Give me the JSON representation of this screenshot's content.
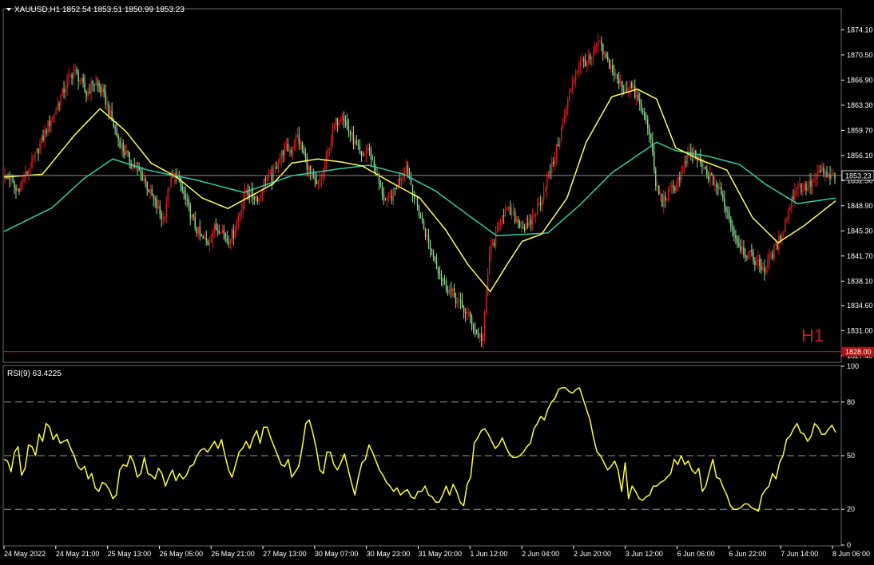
{
  "header": {
    "symbol": "XAUUSD,H1",
    "ohlc": "1852.54 1853.51 1850.99 1853.23"
  },
  "rsi_header": "RSI(9) 63.4225",
  "timeframe_badge": "H1",
  "current_price_label": "1853.23",
  "low_line_label": "1828.00",
  "colors": {
    "background": "#000000",
    "bull": "#d81f1f",
    "bear": "#8fdc8f",
    "ma_fast": "#ffff55",
    "ma_slow": "#2fd0a0",
    "rsi": "#ffff33",
    "low_line": "#b01010",
    "current_line": "#888888"
  },
  "chart_data": [
    {
      "type": "candlestick",
      "title": "XAUUSD,H1",
      "ylim": [
        1826.7,
        1877.0
      ],
      "yticks": [
        "1874.10",
        "1870.50",
        "1866.90",
        "1863.30",
        "1859.70",
        "1856.10",
        "1852.50",
        "1848.90",
        "1845.30",
        "1841.70",
        "1838.10",
        "1834.60",
        "1831.00",
        "1827.40"
      ],
      "xticks": [
        "24 May 2022",
        "24 May 21:00",
        "25 May 13:00",
        "26 May 05:00",
        "26 May 21:00",
        "27 May 13:00",
        "30 May 07:00",
        "30 May 23:00",
        "31 May 20:00",
        "1 Jun 12:00",
        "2 Jun 04:00",
        "2 Jun 20:00",
        "3 Jun 12:00",
        "6 Jun 06:00",
        "6 Jun 22:00",
        "7 Jun 14:00",
        "8 Jun 06:00"
      ],
      "current_price": 1853.23,
      "horizontal_line": 1828.0,
      "close_path": [
        [
          0,
          1852.8
        ],
        [
          4,
          1853.0
        ],
        [
          8,
          1851.0
        ],
        [
          12,
          1852.4
        ],
        [
          16,
          1854.2
        ],
        [
          20,
          1856.0
        ],
        [
          24,
          1858.2
        ],
        [
          28,
          1860.4
        ],
        [
          32,
          1862.2
        ],
        [
          36,
          1864.4
        ],
        [
          40,
          1866.6
        ],
        [
          44,
          1868.2
        ],
        [
          48,
          1867.0
        ],
        [
          52,
          1864.8
        ],
        [
          56,
          1866.6
        ],
        [
          60,
          1866.0
        ],
        [
          64,
          1864.0
        ],
        [
          68,
          1861.0
        ],
        [
          72,
          1858.4
        ],
        [
          76,
          1856.6
        ],
        [
          80,
          1855.0
        ],
        [
          84,
          1854.0
        ],
        [
          88,
          1852.8
        ],
        [
          92,
          1850.6
        ],
        [
          96,
          1848.8
        ],
        [
          100,
          1846.8
        ],
        [
          104,
          1852.0
        ],
        [
          108,
          1853.6
        ],
        [
          112,
          1851.0
        ],
        [
          116,
          1848.4
        ],
        [
          120,
          1846.0
        ],
        [
          124,
          1844.2
        ],
        [
          128,
          1843.6
        ],
        [
          132,
          1845.6
        ],
        [
          136,
          1845.8
        ],
        [
          140,
          1844.0
        ],
        [
          144,
          1845.0
        ],
        [
          148,
          1848.2
        ],
        [
          152,
          1851.2
        ],
        [
          156,
          1850.4
        ],
        [
          160,
          1850.0
        ],
        [
          164,
          1853.0
        ],
        [
          168,
          1852.8
        ],
        [
          172,
          1855.4
        ],
        [
          176,
          1857.2
        ],
        [
          180,
          1856.8
        ],
        [
          184,
          1858.8
        ],
        [
          188,
          1856.2
        ],
        [
          192,
          1853.4
        ],
        [
          196,
          1851.6
        ],
        [
          200,
          1853.4
        ],
        [
          204,
          1857.6
        ],
        [
          208,
          1860.8
        ],
        [
          212,
          1862.2
        ],
        [
          216,
          1859.6
        ],
        [
          220,
          1857.8
        ],
        [
          224,
          1855.6
        ],
        [
          228,
          1857.2
        ],
        [
          232,
          1854.6
        ],
        [
          236,
          1851.4
        ],
        [
          240,
          1849.2
        ],
        [
          244,
          1850.6
        ],
        [
          248,
          1853.0
        ],
        [
          252,
          1854.6
        ],
        [
          256,
          1851.2
        ],
        [
          260,
          1848.0
        ],
        [
          264,
          1845.0
        ],
        [
          268,
          1842.4
        ],
        [
          272,
          1839.8
        ],
        [
          276,
          1837.6
        ],
        [
          280,
          1836.6
        ],
        [
          284,
          1835.2
        ],
        [
          288,
          1834.0
        ],
        [
          292,
          1832.8
        ],
        [
          296,
          1830.6
        ],
        [
          300,
          1829.8
        ],
        [
          304,
          1842.2
        ],
        [
          308,
          1844.4
        ],
        [
          312,
          1848.0
        ],
        [
          316,
          1848.0
        ],
        [
          320,
          1847.2
        ],
        [
          324,
          1846.2
        ],
        [
          328,
          1845.6
        ],
        [
          332,
          1847.6
        ],
        [
          336,
          1849.6
        ],
        [
          340,
          1852.6
        ],
        [
          344,
          1855.2
        ],
        [
          348,
          1858.8
        ],
        [
          352,
          1862.6
        ],
        [
          356,
          1866.8
        ],
        [
          360,
          1869.2
        ],
        [
          364,
          1869.6
        ],
        [
          368,
          1869.8
        ],
        [
          372,
          1872.4
        ],
        [
          376,
          1870.2
        ],
        [
          380,
          1868.8
        ],
        [
          384,
          1866.8
        ],
        [
          388,
          1865.6
        ],
        [
          392,
          1866.2
        ],
        [
          396,
          1864.4
        ],
        [
          400,
          1862.0
        ],
        [
          404,
          1859.8
        ],
        [
          408,
          1852.0
        ],
        [
          412,
          1849.4
        ],
        [
          416,
          1850.6
        ],
        [
          420,
          1851.8
        ],
        [
          424,
          1853.6
        ],
        [
          428,
          1855.8
        ],
        [
          432,
          1856.4
        ],
        [
          436,
          1854.8
        ],
        [
          440,
          1853.4
        ],
        [
          444,
          1852.4
        ],
        [
          448,
          1851.0
        ],
        [
          452,
          1848.6
        ],
        [
          456,
          1845.6
        ],
        [
          460,
          1843.4
        ],
        [
          464,
          1842.2
        ],
        [
          468,
          1841.6
        ],
        [
          472,
          1840.6
        ],
        [
          476,
          1839.8
        ],
        [
          480,
          1841.8
        ],
        [
          484,
          1843.2
        ],
        [
          488,
          1845.8
        ],
        [
          492,
          1849.0
        ],
        [
          496,
          1851.8
        ],
        [
          500,
          1851.4
        ],
        [
          504,
          1851.8
        ],
        [
          508,
          1852.8
        ],
        [
          512,
          1854.0
        ],
        [
          516,
          1852.8
        ],
        [
          520,
          1853.23
        ]
      ],
      "ma_fast": [
        [
          0,
          1853.0
        ],
        [
          24,
          1853.4
        ],
        [
          44,
          1859.0
        ],
        [
          60,
          1862.8
        ],
        [
          76,
          1859.6
        ],
        [
          92,
          1855.0
        ],
        [
          108,
          1853.0
        ],
        [
          124,
          1850.0
        ],
        [
          140,
          1848.5
        ],
        [
          152,
          1850.0
        ],
        [
          168,
          1852.0
        ],
        [
          180,
          1855.0
        ],
        [
          196,
          1855.6
        ],
        [
          210,
          1855.2
        ],
        [
          224,
          1854.6
        ],
        [
          240,
          1852.5
        ],
        [
          260,
          1850.0
        ],
        [
          276,
          1845.5
        ],
        [
          290,
          1840.5
        ],
        [
          304,
          1836.6
        ],
        [
          316,
          1841.0
        ],
        [
          324,
          1843.8
        ],
        [
          336,
          1844.8
        ],
        [
          352,
          1850.0
        ],
        [
          364,
          1858.0
        ],
        [
          380,
          1864.5
        ],
        [
          396,
          1865.6
        ],
        [
          408,
          1864.2
        ],
        [
          420,
          1857.2
        ],
        [
          436,
          1855.4
        ],
        [
          452,
          1854.0
        ],
        [
          468,
          1847.2
        ],
        [
          484,
          1843.6
        ],
        [
          500,
          1846.0
        ],
        [
          520,
          1849.6
        ]
      ],
      "ma_slow": [
        [
          0,
          1845.2
        ],
        [
          30,
          1848.6
        ],
        [
          50,
          1852.8
        ],
        [
          68,
          1855.6
        ],
        [
          90,
          1854.0
        ],
        [
          120,
          1852.6
        ],
        [
          150,
          1850.8
        ],
        [
          180,
          1853.2
        ],
        [
          210,
          1854.2
        ],
        [
          228,
          1854.7
        ],
        [
          250,
          1853.4
        ],
        [
          270,
          1851.0
        ],
        [
          290,
          1847.6
        ],
        [
          308,
          1844.6
        ],
        [
          324,
          1844.8
        ],
        [
          340,
          1845.0
        ],
        [
          360,
          1849.0
        ],
        [
          380,
          1853.6
        ],
        [
          408,
          1858.0
        ],
        [
          420,
          1856.8
        ],
        [
          440,
          1856.0
        ],
        [
          460,
          1854.8
        ],
        [
          476,
          1852.0
        ],
        [
          496,
          1849.2
        ],
        [
          520,
          1850.0
        ]
      ]
    },
    {
      "type": "line",
      "title": "RSI(9) 63.4225",
      "ylim": [
        0,
        100
      ],
      "yticks": [
        0,
        20,
        50,
        80,
        100
      ],
      "reference_lines": [
        20,
        50,
        80
      ],
      "series": [
        {
          "name": "RSI(9)",
          "values": [
            48,
            47,
            41,
            52,
            55,
            39,
            43,
            56,
            55,
            50,
            62,
            58,
            68,
            66,
            59,
            62,
            57,
            58,
            59,
            54,
            50,
            44,
            42,
            44,
            37,
            40,
            32,
            30,
            35,
            34,
            31,
            26,
            28,
            42,
            45,
            44,
            50,
            46,
            38,
            40,
            49,
            40,
            39,
            37,
            43,
            40,
            33,
            38,
            42,
            36,
            40,
            37,
            39,
            44,
            45,
            50,
            53,
            54,
            52,
            55,
            58,
            54,
            59,
            50,
            42,
            38,
            45,
            52,
            54,
            58,
            54,
            60,
            64,
            57,
            66,
            66,
            60,
            55,
            50,
            45,
            44,
            48,
            38,
            41,
            44,
            55,
            68,
            70,
            63,
            54,
            42,
            40,
            52,
            52,
            45,
            42,
            46,
            51,
            43,
            35,
            28,
            38,
            46,
            48,
            56,
            52,
            47,
            42,
            39,
            35,
            33,
            30,
            32,
            28,
            30,
            31,
            27,
            26,
            30,
            30,
            33,
            28,
            27,
            24,
            24,
            28,
            33,
            28,
            34,
            30,
            24,
            22,
            34,
            38,
            57,
            60,
            64,
            65,
            62,
            58,
            54,
            56,
            60,
            55,
            51,
            49,
            49,
            50,
            52,
            55,
            57,
            65,
            68,
            72,
            70,
            76,
            80,
            82,
            87,
            88,
            88,
            86,
            85,
            87,
            88,
            82,
            76,
            70,
            60,
            52,
            50,
            46,
            42,
            44,
            47,
            42,
            30,
            46,
            26,
            33,
            30,
            26,
            25,
            27,
            28,
            33,
            33,
            35,
            36,
            38,
            40,
            48,
            45,
            50,
            45,
            47,
            42,
            40,
            43,
            30,
            33,
            41,
            48,
            38,
            37,
            32,
            28,
            22,
            20,
            20,
            21,
            23,
            23,
            21,
            20,
            19,
            28,
            31,
            33,
            40,
            37,
            46,
            50,
            59,
            61,
            65,
            68,
            63,
            62,
            58,
            61,
            68,
            66,
            62,
            62,
            65,
            67,
            63
          ]
        }
      ]
    }
  ]
}
